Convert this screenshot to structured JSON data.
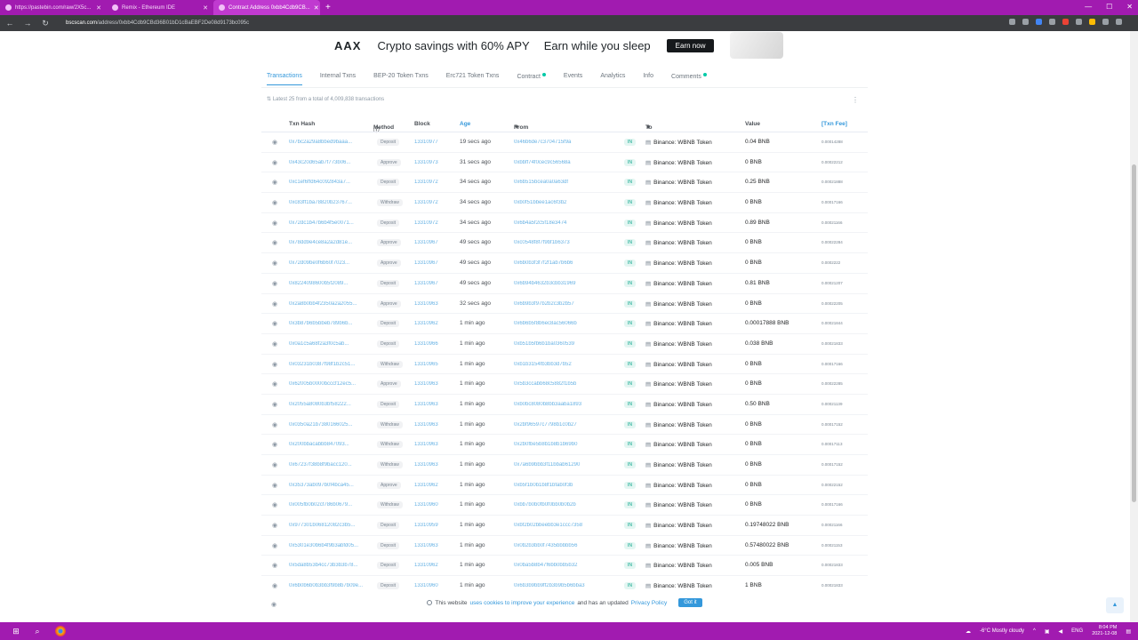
{
  "browser": {
    "tabs": [
      {
        "title": "https://pastebin.com/raw/2X5c...",
        "active": false
      },
      {
        "title": "Remix - Ethereum IDE",
        "active": false
      },
      {
        "title": "Contract Address 0xbb4Cdb9CB...",
        "active": true
      }
    ],
    "new_tab": "+",
    "url_host": "bscscan.com",
    "url_path": "/address/0xbb4Cdb9CBd36B01bD1cBaEBF2De08d9173bc095c"
  },
  "ad": {
    "logo": "AAX",
    "headline": "Crypto savings with 60% APY",
    "tagline": "Earn while you sleep",
    "button": "Earn now"
  },
  "subtabs": [
    {
      "label": "Transactions",
      "active": true,
      "dot": false
    },
    {
      "label": "Internal Txns",
      "active": false,
      "dot": false
    },
    {
      "label": "BEP-20 Token Txns",
      "active": false,
      "dot": false
    },
    {
      "label": "Erc721 Token Txns",
      "active": false,
      "dot": false
    },
    {
      "label": "Contract",
      "active": false,
      "dot": true
    },
    {
      "label": "Events",
      "active": false,
      "dot": false
    },
    {
      "label": "Analytics",
      "active": false,
      "dot": false
    },
    {
      "label": "Info",
      "active": false,
      "dot": false
    },
    {
      "label": "Comments",
      "active": false,
      "dot": true
    }
  ],
  "summary": "Latest 25 from a total of 4,009,838 transactions",
  "columns": {
    "hash": "Txn Hash",
    "method": "Method",
    "block": "Block",
    "age": "Age",
    "from": "From",
    "to": "To",
    "value": "Value",
    "fee": "[Txn Fee]"
  },
  "rows": [
    {
      "hash": "0x7bc2a29a8bbed9baaa...",
      "method": "Deposit",
      "block": "13310977",
      "age": "19 secs ago",
      "from": "0x46b6de7c3704715f9a",
      "to": "Binance: WBNB Token",
      "value": "0.04 BNB",
      "fee": "0.00014288"
    },
    {
      "hash": "0x43c20d65ab7f773b06...",
      "method": "Approve",
      "block": "13310973",
      "age": "31 secs ago",
      "from": "0xbbff74f0cec9c56568a",
      "to": "Binance: WBNB Token",
      "value": "0 BNB",
      "fee": "0.00022212"
    },
    {
      "hash": "0xc1ef6ffd64c092843a7...",
      "method": "Deposit",
      "block": "13310972",
      "age": "34 secs ago",
      "from": "0x6b515bcea0a0a63df",
      "to": "Binance: WBNB Token",
      "value": "0.25 BNB",
      "fee": "0.00021888"
    },
    {
      "hash": "0xc83ff1ba78820b23767...",
      "method": "Withdraw",
      "block": "13310972",
      "age": "34 secs ago",
      "from": "0xb0f51bbee1ac6f3b2",
      "to": "Binance: WBNB Token",
      "value": "0 BNB",
      "fee": "0.00017166"
    },
    {
      "hash": "0x72dc1b47b6b4f5e0071...",
      "method": "Deposit",
      "block": "13310972",
      "age": "34 secs ago",
      "from": "0x6b4a5f2c5f18e3474",
      "to": "Binance: WBNB Token",
      "value": "0.89 BNB",
      "fee": "0.00021166"
    },
    {
      "hash": "0x78dd9e4ce8a2a2d81e...",
      "method": "Approve",
      "block": "13310967",
      "age": "49 secs ago",
      "from": "0xc0548f8f7f9bf1b6373",
      "to": "Binance: WBNB Token",
      "value": "0 BNB",
      "fee": "0.00022284"
    },
    {
      "hash": "0x72d09be0f6b60f7023...",
      "method": "Approve",
      "block": "13310967",
      "age": "49 secs ago",
      "from": "0x6b0b3f3f7f2f1ab7b6b6",
      "to": "Binance: WBNB Token",
      "value": "0 BNB",
      "fee": "0.0002222"
    },
    {
      "hash": "0x8224098600b5f2089...",
      "method": "Deposit",
      "block": "13310967",
      "age": "49 secs ago",
      "from": "0x6b94b4632b3cbb31969",
      "to": "Binance: WBNB Token",
      "value": "0.81 BNB",
      "fee": "0.00021207"
    },
    {
      "hash": "0x2a8b0bb4f2350a2a2055...",
      "method": "Approve",
      "block": "13310963",
      "age": "32 secs ago",
      "from": "0x6b9b3f97b2b2c3b2b57",
      "to": "Binance: WBNB Token",
      "value": "0 BNB",
      "fee": "0.00022205"
    },
    {
      "hash": "0x3b87b6b5bbeb789b6b...",
      "method": "Deposit",
      "block": "13310962",
      "age": "1 min ago",
      "from": "0x6b6b5f8b6ec8ac56066b",
      "to": "Binance: WBNB Token",
      "value": "0.00017888 BNB",
      "fee": "0.00021844"
    },
    {
      "hash": "0x0a1c5a68f2a3f0c5ab...",
      "method": "Deposit",
      "block": "13310966",
      "age": "1 min ago",
      "from": "0xb51b5fb6b1ba0360539",
      "to": "Binance: WBNB Token",
      "value": "0.038 BNB",
      "fee": "0.00021833"
    },
    {
      "hash": "0x03231b0387f98f1b2c51...",
      "method": "Withdraw",
      "block": "13310965",
      "age": "1 min ago",
      "from": "0xb1b3154fb3bb3d7b52",
      "to": "Binance: WBNB Token",
      "value": "0 BNB",
      "fee": "0.00017166"
    },
    {
      "hash": "0x62005b0000bcccf12ec5...",
      "method": "Approve",
      "block": "13310963",
      "age": "1 min ago",
      "from": "0x5b3ccabb68c5882f1b5b",
      "to": "Binance: WBNB Token",
      "value": "0 BNB",
      "fee": "0.00022285"
    },
    {
      "hash": "0x2055a8080b3bf58222...",
      "method": "Deposit",
      "block": "13310963",
      "age": "1 min ago",
      "from": "0xb0bc8080b8bb3aaba1893",
      "to": "Binance: WBNB Token",
      "value": "0.50 BNB",
      "fee": "0.00021139"
    },
    {
      "hash": "0x0350a21b7380166025...",
      "method": "Withdraw",
      "block": "13310963",
      "age": "1 min ago",
      "from": "0x2bf96597c7798b1c0b27",
      "to": "Binance: WBNB Token",
      "value": "0 BNB",
      "fee": "0.00017152"
    },
    {
      "hash": "0x200bbacabbb847093...",
      "method": "Withdraw",
      "block": "13310963",
      "age": "1 min ago",
      "from": "0x2b0fbe5b8b1b8b1b69b0",
      "to": "Binance: WBNB Token",
      "value": "0 BNB",
      "fee": "0.00017113"
    },
    {
      "hash": "0x67237f38b8f9bacc120...",
      "method": "Withdraw",
      "block": "13310963",
      "age": "1 min ago",
      "from": "0x7a6b9bbb3f11bbab61290",
      "to": "Binance: WBNB Token",
      "value": "0 BNB",
      "fee": "0.00017152"
    },
    {
      "hash": "0x35373ab097b0f4bca45...",
      "method": "Approve",
      "block": "13310962",
      "age": "1 min ago",
      "from": "0xb5f1b0b1b8f1bfab0f3b",
      "to": "Binance: WBNB Token",
      "value": "0 BNB",
      "fee": "0.00022152"
    },
    {
      "hash": "0x005fb0b02cf786b0679...",
      "method": "Withdraw",
      "block": "13310960",
      "age": "1 min ago",
      "from": "0xbb7b0b0fb0f0bb0b0b2b",
      "to": "Binance: WBNB Token",
      "value": "0 BNB",
      "fee": "0.00017166"
    },
    {
      "hash": "0x977301b06812082c3b5...",
      "method": "Deposit",
      "block": "13310959",
      "age": "1 min ago",
      "from": "0xbf2b02bbeebb3e1ccc7358",
      "to": "Binance: WBNB Token",
      "value": "0.19748022 BNB",
      "fee": "0.00021166"
    },
    {
      "hash": "0x5301e30b6b4f9b3abfd05...",
      "method": "Deposit",
      "block": "13310963",
      "age": "1 min ago",
      "from": "0x0b2b3bb0f7435bbbbb56",
      "to": "Binance: WBNB Token",
      "value": "0.57480022 BNB",
      "fee": "0.00021153"
    },
    {
      "hash": "0x5da8b53b4cc73b3b3b78...",
      "method": "Deposit",
      "block": "13310962",
      "age": "1 min ago",
      "from": "0x0ba5b8b47f6bb0bb5b32",
      "to": "Binance: WBNB Token",
      "value": "0.005 BNB",
      "fee": "0.00021833"
    },
    {
      "hash": "0x6b0b6b0b3bb3f9b8b7b09e...",
      "method": "Deposit",
      "block": "13310960",
      "age": "1 min ago",
      "from": "0x6b3b9bb9ff2b3b9b5b6bba3",
      "to": "Binance: WBNB Token",
      "value": "1 BNB",
      "fee": "0.00021833"
    }
  ],
  "cookie": {
    "pre": "This website",
    "link1": "uses cookies to improve your experience",
    "mid": "and has an updated",
    "link2": "Privacy Policy",
    "button": "Got it"
  },
  "taskbar": {
    "weather": "-6°C  Mostly cloudy",
    "lang": "ENG",
    "time": "8:04 PM",
    "date": "2021-12-08"
  }
}
